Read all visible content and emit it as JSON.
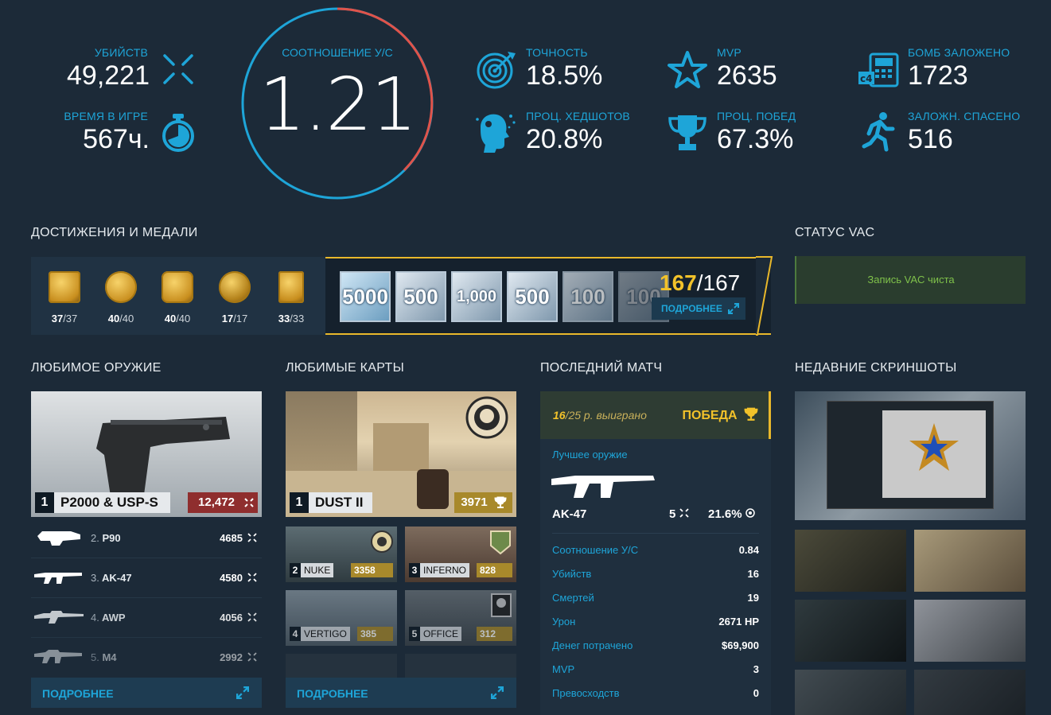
{
  "stats": {
    "kills": {
      "label": "УБИЙСТВ",
      "value": "49,221"
    },
    "time": {
      "label": "ВРЕМЯ В ИГРЕ",
      "value": "567ч."
    },
    "ratio": {
      "label": "СООТНОШЕНИЕ У/С",
      "value": "1.21"
    },
    "accuracy": {
      "label": "ТОЧНОСТЬ",
      "value": "18.5%"
    },
    "headshots": {
      "label": "ПРОЦ. ХЕДШОТОВ",
      "value": "20.8%"
    },
    "mvp": {
      "label": "MVP",
      "value": "2635"
    },
    "wins": {
      "label": "ПРОЦ. ПОБЕД",
      "value": "67.3%"
    },
    "planted": {
      "label": "БОМБ ЗАЛОЖЕНО",
      "value": "1723"
    },
    "defused": {
      "label": "ЗАЛОЖН. СПАСЕНО",
      "value": "516"
    },
    "c4_text": "c4"
  },
  "achievements": {
    "title": "ДОСТИЖЕНИЯ И МЕДАЛИ",
    "items": [
      {
        "have": "37",
        "total": "/37"
      },
      {
        "have": "40",
        "total": "/40"
      },
      {
        "have": "40",
        "total": "/40"
      },
      {
        "have": "17",
        "total": "/17"
      },
      {
        "have": "33",
        "total": "/33"
      }
    ],
    "coins": [
      "5000",
      "500",
      "1,000",
      "500",
      "100",
      "100"
    ],
    "coin_have": "167",
    "coin_total": "/167",
    "more_label": "ПОДРОБНЕЕ"
  },
  "vac": {
    "title": "СТАТУС VAC",
    "status": "Запись VAC чиста"
  },
  "weapons": {
    "title": "ЛЮБИМОЕ ОРУЖИЕ",
    "top": {
      "rank": "1",
      "name": "P2000 & USP-S",
      "kills": "12,472"
    },
    "list": [
      {
        "rank": "2.",
        "name": "P90",
        "kills": "4685"
      },
      {
        "rank": "3.",
        "name": "AK-47",
        "kills": "4580"
      },
      {
        "rank": "4.",
        "name": "AWP",
        "kills": "4056"
      },
      {
        "rank": "5.",
        "name": "M4",
        "kills": "2992"
      }
    ],
    "more_label": "ПОДРОБНЕЕ"
  },
  "maps": {
    "title": "ЛЮБИМЫЕ КАРТЫ",
    "top": {
      "rank": "1",
      "name": "DUST II",
      "score": "3971"
    },
    "list": [
      {
        "rank": "2",
        "name": "NUKE",
        "score": "3358"
      },
      {
        "rank": "3",
        "name": "INFERNO",
        "score": "828"
      },
      {
        "rank": "4",
        "name": "VERTIGO",
        "score": "385"
      },
      {
        "rank": "5",
        "name": "OFFICE",
        "score": "312"
      }
    ],
    "more_label": "ПОДРОБНЕЕ"
  },
  "match": {
    "title": "ПОСЛЕДНИЙ МАТЧ",
    "rounds_won": "16",
    "rounds_text": "/25 р. выиграно",
    "result": "ПОБЕДА",
    "best_weapon_label": "Лучшее оружие",
    "best_weapon": "AK-47",
    "best_kills": "5",
    "best_hs": "21.6%",
    "rows": [
      {
        "label": "Соотношение У/С",
        "value": "0.84"
      },
      {
        "label": "Убийств",
        "value": "16"
      },
      {
        "label": "Смертей",
        "value": "19"
      },
      {
        "label": "Урон",
        "value": "2671 HP"
      },
      {
        "label": "Денег потрачено",
        "value": "$69,900"
      },
      {
        "label": "MVP",
        "value": "3"
      },
      {
        "label": "Превосходств",
        "value": "0"
      }
    ]
  },
  "screenshots": {
    "title": "НЕДАВНИЕ СКРИНШОТЫ"
  },
  "colors": {
    "accent": "#1ea5d8",
    "gold": "#f2c22a",
    "red_arc": "#e0534a",
    "vac_green": "#7fc14a"
  }
}
